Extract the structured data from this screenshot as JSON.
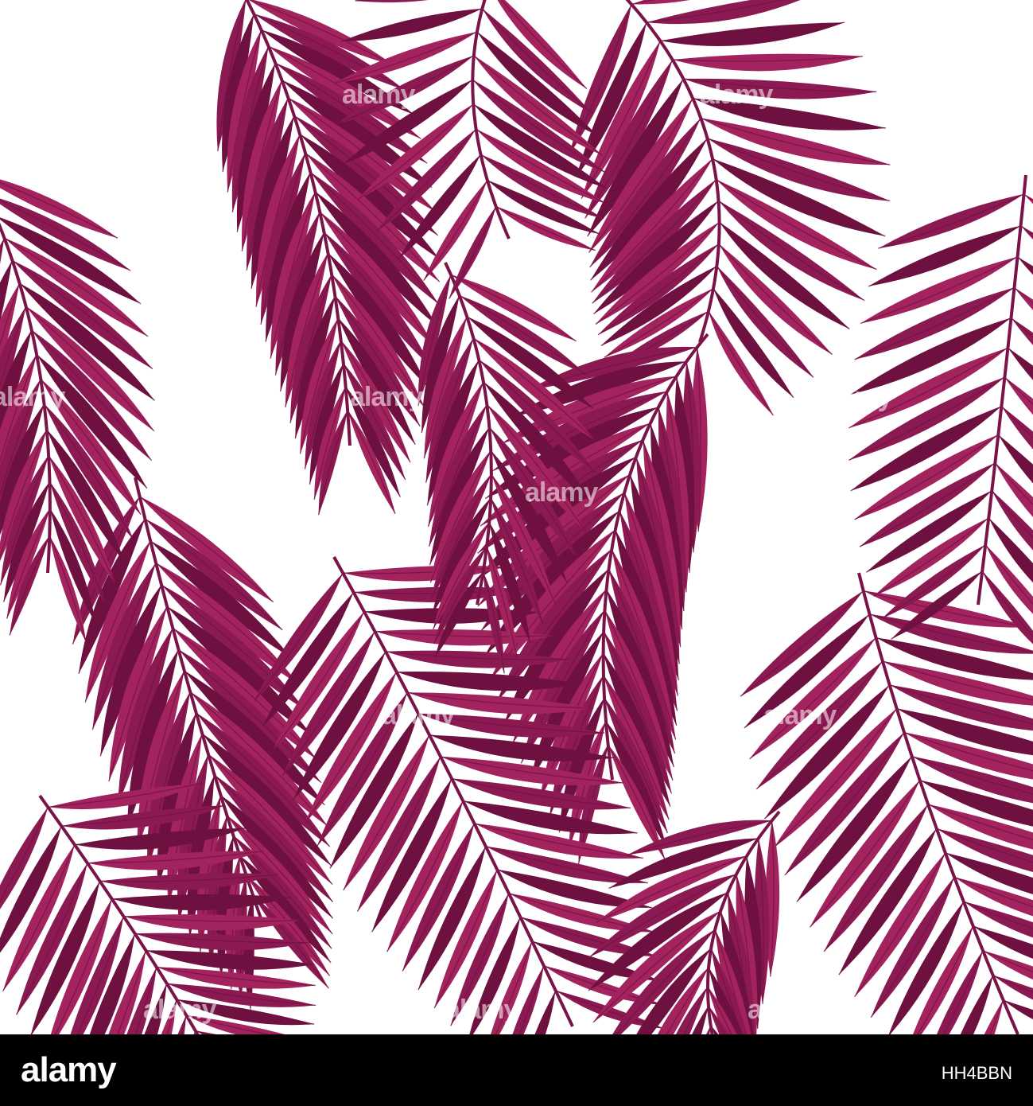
{
  "image": {
    "kind": "seamless tropical palm leaf pattern",
    "colors": {
      "background": "#ffffff",
      "leaf_light": "#a3235f",
      "leaf_mid": "#8c1a52",
      "leaf_dark": "#6e1140",
      "stem": "#7a1448"
    }
  },
  "watermark": {
    "text": "alamy"
  },
  "footer": {
    "logo": "alamy",
    "image_id": "HH4BBN",
    "background": "#000000",
    "text_color": "#ffffff"
  }
}
